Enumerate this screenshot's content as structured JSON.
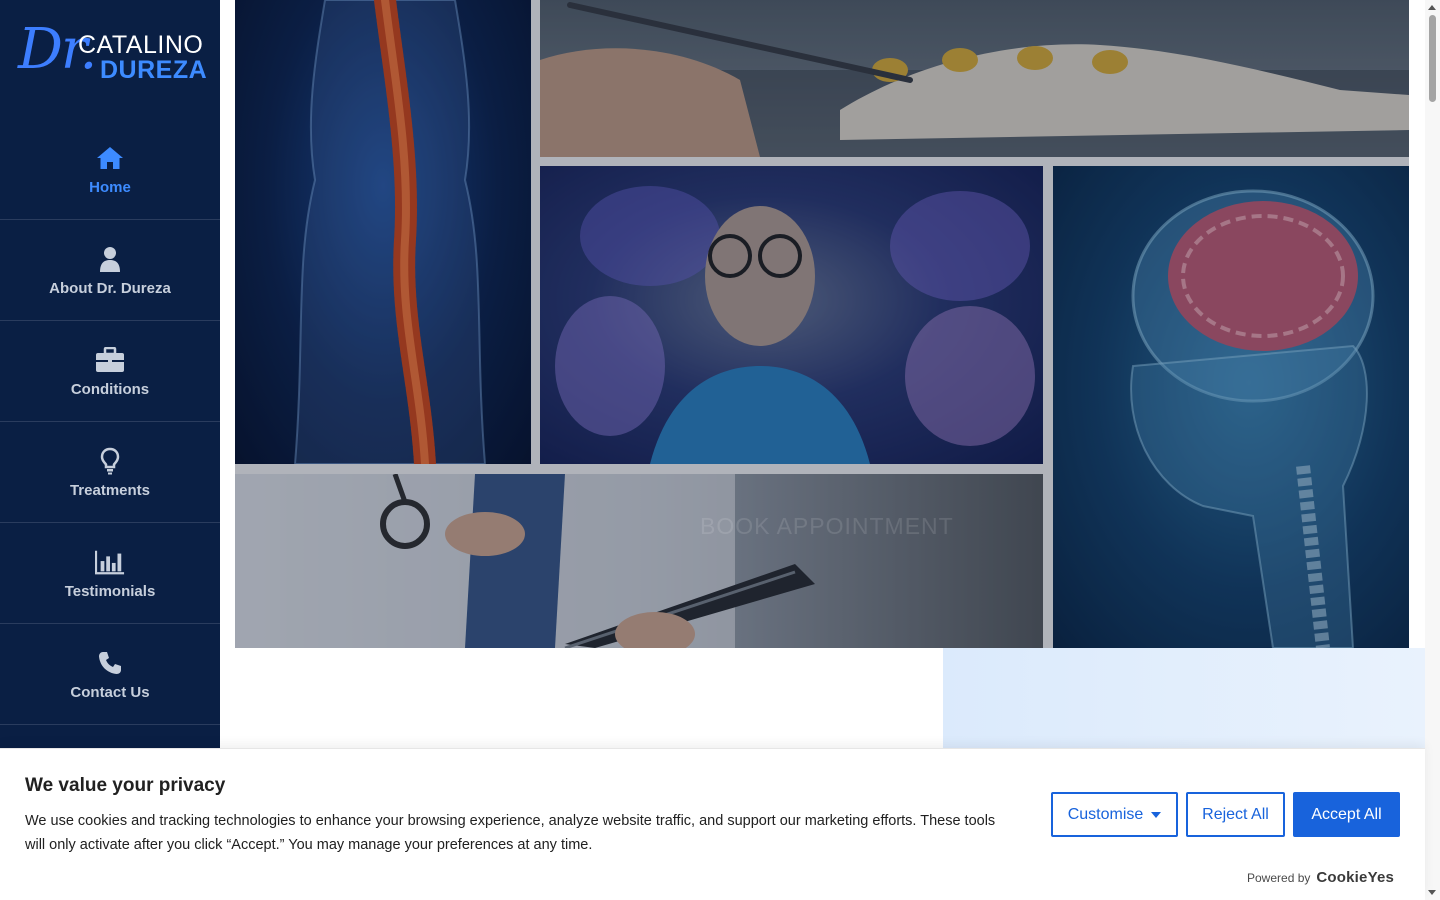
{
  "brand": {
    "dr": "Dr.",
    "first_name": "CATALINO",
    "last_name": "DUREZA"
  },
  "nav": {
    "items": [
      {
        "label": "Home",
        "icon": "home-icon"
      },
      {
        "label": "About Dr. Dureza",
        "icon": "user-icon"
      },
      {
        "label": "Conditions",
        "icon": "briefcase-icon"
      },
      {
        "label": "Treatments",
        "icon": "lightbulb-icon"
      },
      {
        "label": "Testimonials",
        "icon": "bar-chart-icon"
      },
      {
        "label": "Contact Us",
        "icon": "phone-icon"
      }
    ],
    "active_index": 0
  },
  "hero": {
    "ghost_button": "BOOK APPOINTMENT"
  },
  "cookie_banner": {
    "title": "We value your privacy",
    "text": "We use cookies and tracking technologies to enhance your browsing experience, analyze website traffic, and support our marketing efforts. These tools will only activate after you click “Accept.” You may manage your preferences at any time.",
    "customise_label": "Customise",
    "reject_label": "Reject All",
    "accept_label": "Accept All",
    "powered_by": "Powered by",
    "powered_brand": "CookieYes"
  },
  "colors": {
    "sidebar_bg": "#0a1f44",
    "accent": "#3d8bff",
    "cookie_primary": "#1863dc"
  }
}
